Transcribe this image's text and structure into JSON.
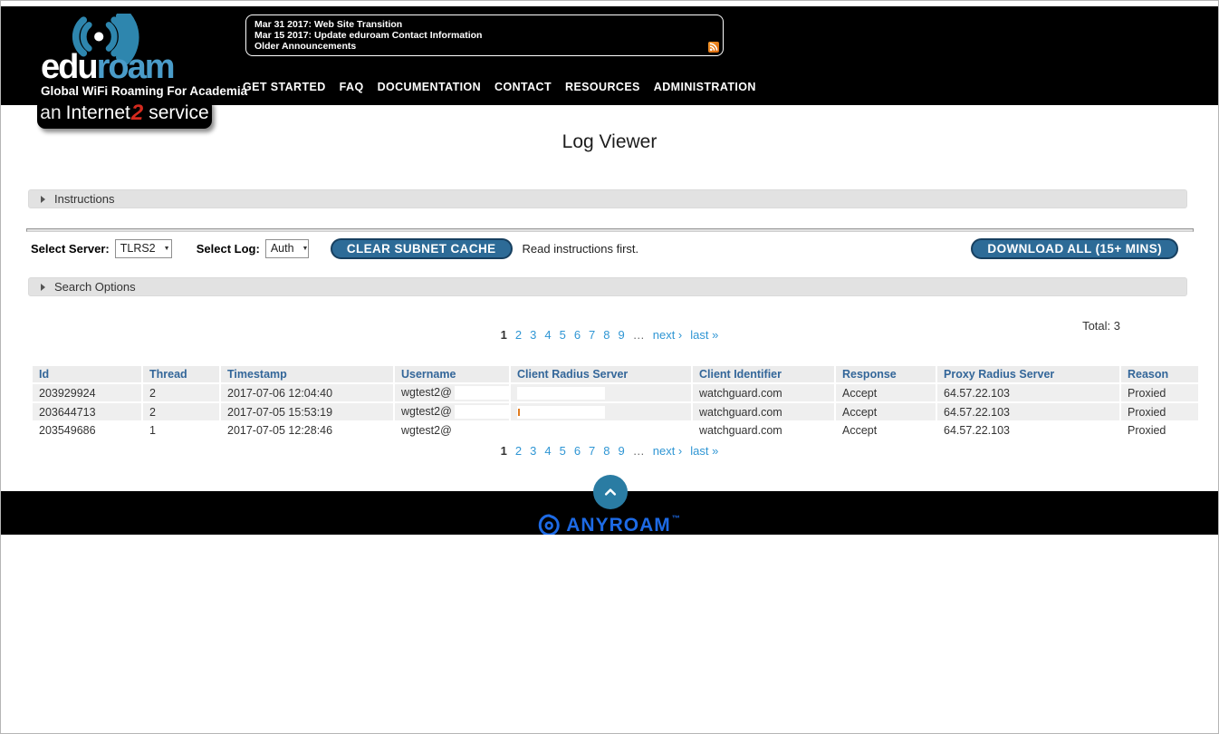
{
  "window": {
    "title": "Log Viewer"
  },
  "header": {
    "logo": {
      "brand_edu": "edu",
      "brand_roam": "roam",
      "tagline": "Global WiFi Roaming For Academia",
      "wifi_icon": "wifi-arcs-icon"
    },
    "badge": {
      "an": "an",
      "internet": "Internet",
      "two": "2",
      "service": "service"
    },
    "announcements": {
      "line1": "Mar 31 2017:  Web Site Transition",
      "line2": "Mar 15 2017:  Update eduroam Contact Information",
      "older_link": "Older Announcements",
      "rss_icon": "rss-icon"
    },
    "nav": {
      "items": [
        {
          "label": "GET STARTED"
        },
        {
          "label": "FAQ"
        },
        {
          "label": "DOCUMENTATION"
        },
        {
          "label": "CONTACT"
        },
        {
          "label": "RESOURCES"
        },
        {
          "label": "ADMINISTRATION"
        }
      ]
    }
  },
  "page_title": "Log Viewer",
  "sections": {
    "instructions_label": "Instructions",
    "search_options_label": "Search Options",
    "caret_icon": "triangle-right-icon"
  },
  "controls": {
    "select_server_label": "Select Server:",
    "server_value": "TLRS2",
    "select_log_label": "Select Log:",
    "log_value": "Auth",
    "clear_cache_button": "CLEAR SUBNET CACHE",
    "note": "Read instructions first.",
    "download_button": "DOWNLOAD ALL (15+ MINS)"
  },
  "results": {
    "total_label": "Total: 3"
  },
  "pagination": {
    "current": "1",
    "pages": [
      "2",
      "3",
      "4",
      "5",
      "6",
      "7",
      "8",
      "9"
    ],
    "ellipsis": "…",
    "next": "next ›",
    "last": "last »"
  },
  "table": {
    "columns": [
      "Id",
      "Thread",
      "Timestamp",
      "Username",
      "Client Radius Server",
      "Client Identifier",
      "Response",
      "Proxy Radius Server",
      "Reason"
    ],
    "rows": [
      {
        "cells": [
          "203929924",
          "2",
          "2017-07-06 12:04:40",
          "wgtest2@",
          "",
          "watchguard.com",
          "Accept",
          "64.57.22.103",
          "Proxied"
        ]
      },
      {
        "cells": [
          "203644713",
          "2",
          "2017-07-05 15:53:19",
          "wgtest2@",
          "",
          "watchguard.com",
          "Accept",
          "64.57.22.103",
          "Proxied"
        ]
      },
      {
        "cells": [
          "203549686",
          "1",
          "2017-07-05 12:28:46",
          "wgtest2@",
          "",
          "watchguard.com",
          "Accept",
          "64.57.22.103",
          "Proxied"
        ]
      }
    ],
    "redaction_note": "client radius server and username domains hidden by white boxes"
  },
  "footer": {
    "back_to_top_icon": "chevron-up-icon",
    "anyroam_logo_icon": "anyroam-swirl-icon",
    "anyroam": "ANYROAM",
    "trademark": "™"
  },
  "colors": {
    "header_bg": "#000000",
    "eduroam_blue": "#4a9cc9",
    "internet2_red": "#d42a1e",
    "button_blue": "#2d6b97",
    "button_border": "#173f5f",
    "link_blue": "#2f96d4",
    "table_header_text": "#336699",
    "row_stripe": "#efefef",
    "rss_orange": "#e8731a",
    "back_to_top_circle": "#2a7ca3",
    "anyroam_blue": "#1d6ae5"
  }
}
